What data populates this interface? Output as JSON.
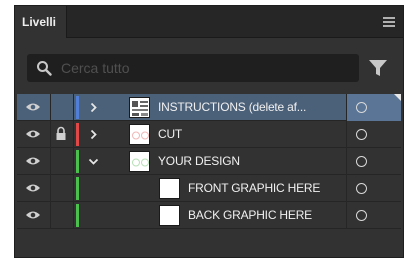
{
  "panel": {
    "tab_label": "Livelli"
  },
  "search": {
    "placeholder": "Cerca tutto",
    "value": ""
  },
  "colors": {
    "panel_bg": "#323232",
    "selected_row": "#4b6079",
    "instructions_layer": "#4f7fd8",
    "cut_layer": "#e04848",
    "design_layer": "#4cc04c"
  },
  "layers": [
    {
      "label": "INSTRUCTIONS (delete af...",
      "visible": true,
      "locked": false,
      "expanded": false,
      "selected": true,
      "color": "#4f7fd8",
      "icon": "chevron-right-icon"
    },
    {
      "label": "CUT",
      "visible": true,
      "locked": true,
      "expanded": false,
      "selected": false,
      "color": "#e04848",
      "icon": "chevron-right-icon"
    },
    {
      "label": "YOUR DESIGN",
      "visible": true,
      "locked": false,
      "expanded": true,
      "selected": false,
      "color": "#4cc04c",
      "icon": "chevron-down-icon"
    },
    {
      "label": "FRONT GRAPHIC HERE",
      "visible": true,
      "locked": false,
      "expanded": false,
      "selected": false,
      "color": "#4cc04c",
      "sublayer": true
    },
    {
      "label": "BACK GRAPHIC HERE",
      "visible": true,
      "locked": false,
      "expanded": false,
      "selected": false,
      "color": "#4cc04c",
      "sublayer": true
    }
  ]
}
